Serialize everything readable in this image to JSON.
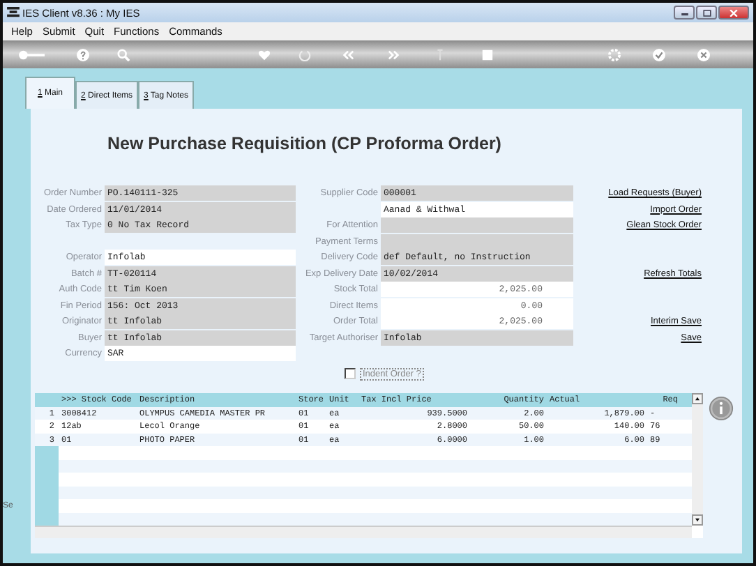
{
  "window": {
    "title": "IES Client v8.36 : My IES"
  },
  "menu": [
    "Help",
    "Submit",
    "Quit",
    "Functions",
    "Commands"
  ],
  "tabs": [
    {
      "label": "1 Main",
      "selected": true
    },
    {
      "label": "2 Direct Items",
      "selected": false
    },
    {
      "label": "3 Tag Notes",
      "selected": false
    }
  ],
  "heading": "New Purchase Requisition (CP Proforma Order)",
  "rows": [
    {
      "left": {
        "label": "Order Number",
        "value": "PO.140111-325",
        "shaded": true
      },
      "right": {
        "label": "Supplier Code",
        "value": "000001",
        "shaded": true,
        "kind": "text"
      },
      "link": "Load Requests (Buyer)"
    },
    {
      "left": {
        "label": "Date Ordered",
        "value": "11/01/2014",
        "shaded": true
      },
      "right": {
        "value": "Aanad & Withwal",
        "shaded": false,
        "kind": "text"
      },
      "link": "Import Order"
    },
    {
      "left": {
        "label": "Tax Type",
        "value": "0 No Tax Record",
        "shaded": true
      },
      "right": {
        "label": "For Attention",
        "shaded": true,
        "kind": "text"
      },
      "link": "Glean Stock Order"
    },
    {
      "right": {
        "label": "Payment Terms",
        "shaded": true,
        "kind": "text"
      }
    },
    {
      "left": {
        "label": "Operator",
        "value": "Infolab",
        "shaded": false
      },
      "right": {
        "label": "Delivery Code",
        "value": "def Default, no Instruction",
        "shaded": true,
        "kind": "text"
      }
    },
    {
      "left": {
        "label": "Batch #",
        "value": "TT-020114",
        "shaded": true
      },
      "right": {
        "label": "Exp Delivery Date",
        "value": "10/02/2014",
        "shaded": true,
        "kind": "text"
      },
      "link": "Refresh Totals"
    },
    {
      "left": {
        "label": "Auth Code",
        "value": "tt Tim Koen",
        "shaded": true
      },
      "right": {
        "label": "Stock Total",
        "value": "2,025.00",
        "shaded": false,
        "kind": "amount"
      }
    },
    {
      "left": {
        "label": "Fin Period",
        "value": "156: Oct 2013",
        "shaded": true
      },
      "right": {
        "label": "Direct Items",
        "value": "0.00",
        "shaded": false,
        "kind": "amount"
      }
    },
    {
      "left": {
        "label": "Originator",
        "value": "tt Infolab",
        "shaded": true
      },
      "right": {
        "label": "Order Total",
        "value": "2,025.00",
        "shaded": false,
        "kind": "amount"
      },
      "link": "Interim Save"
    },
    {
      "left": {
        "label": "Buyer",
        "value": "tt Infolab",
        "shaded": true
      },
      "right": {
        "label": "Target Authoriser",
        "value": "Infolab",
        "shaded": true,
        "kind": "text"
      },
      "link": "Save"
    },
    {
      "left": {
        "label": "Currency",
        "value": "SAR",
        "shaded": false
      }
    }
  ],
  "indent_order": {
    "label": "Indent Order ?",
    "checked": false
  },
  "table": {
    "columns": [
      ">>> Stock Code",
      "Description",
      "Store",
      "Unit",
      "Tax Incl Price",
      "Quantity",
      "Actual",
      "Req"
    ],
    "rows": [
      {
        "number": "1",
        "cells": [
          "3008412",
          "OLYMPUS CAMEDIA MASTER PR",
          "01",
          "ea",
          "939.5000",
          "2.00",
          "1,879.00",
          "-"
        ]
      },
      {
        "number": "2",
        "cells": [
          "12ab",
          "Lecol Orange",
          "01",
          "ea",
          "2.8000",
          "50.00",
          "140.00",
          "76"
        ]
      },
      {
        "number": "3",
        "cells": [
          "01",
          "PHOTO PAPER",
          "01",
          "ea",
          "6.0000",
          "1.00",
          "6.00",
          "89"
        ]
      }
    ]
  },
  "side_text": "Se"
}
